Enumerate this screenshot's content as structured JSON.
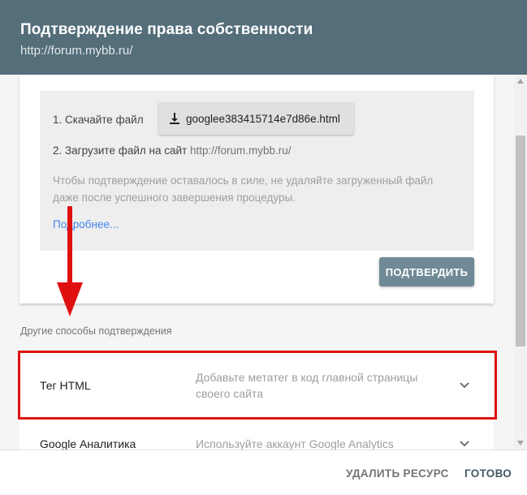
{
  "header": {
    "title": "Подтверждение права собственности",
    "subtitle": "http://forum.mybb.ru/"
  },
  "card": {
    "step1_label": "1. Скачайте файл",
    "download_file": "googlee383415714e7d86e.html",
    "step2_label": "2. Загрузите файл на сайт",
    "step2_url": "http://forum.mybb.ru/",
    "note": "Чтобы подтверждение оставалось в силе, не удаляйте загруженный файл даже после успешного завершения процедуры.",
    "more_link": "Подробнее...",
    "confirm_button": "ПОДТВЕРДИТЬ"
  },
  "other_methods": {
    "heading": "Другие способы подтверждения",
    "items": [
      {
        "name": "Тег HTML",
        "description": "Добавьте метатег в код главной страницы своего сайта"
      },
      {
        "name": "Google Аналитика",
        "description": "Используйте аккаунт Google Analytics"
      }
    ]
  },
  "footer": {
    "delete_button": "УДАЛИТЬ РЕСУРС",
    "done_button": "ГОТОВО"
  },
  "colors": {
    "header_bg": "#546e7a",
    "confirm_bg": "#6f8a96",
    "link": "#4285f4",
    "highlight": "#e01010"
  },
  "icons": [
    "download-icon",
    "chevron-down-icon",
    "red-arrow-down"
  ]
}
